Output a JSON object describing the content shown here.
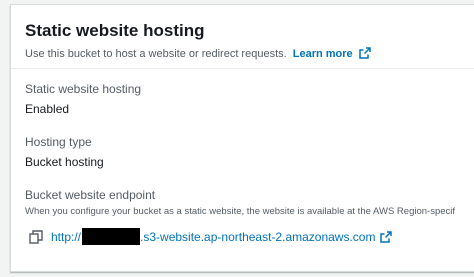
{
  "panel": {
    "title": "Static website hosting",
    "description": "Use this bucket to host a website or redirect requests.",
    "learn_more": "Learn more"
  },
  "fields": {
    "hosting_label": "Static website hosting",
    "hosting_value": "Enabled",
    "type_label": "Hosting type",
    "type_value": "Bucket hosting",
    "endpoint_label": "Bucket website endpoint",
    "endpoint_note": "When you configure your bucket as a static website, the website is available at the AWS Region-specif",
    "endpoint_prefix": "http://",
    "endpoint_suffix": ".s3-website.ap-northeast-2.amazonaws.com"
  },
  "colors": {
    "link": "#0073bb",
    "text": "#16191f",
    "secondary": "#545b64"
  },
  "icons": {
    "learn_more": "external-link-icon",
    "copy": "copy-icon",
    "endpoint_external": "external-link-icon"
  }
}
